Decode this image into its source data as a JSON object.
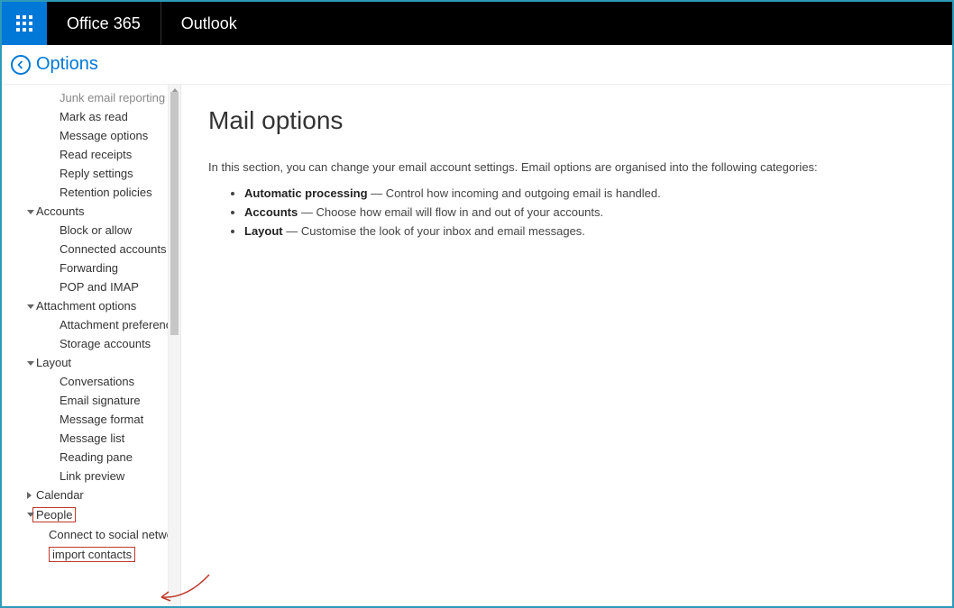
{
  "topbar": {
    "brand": "Office 365",
    "appname": "Outlook"
  },
  "subheader": {
    "back_label": "Options"
  },
  "sidebar": {
    "orphan_items": [
      "Junk email reporting",
      "Mark as read",
      "Message options",
      "Read receipts",
      "Reply settings",
      "Retention policies"
    ],
    "groups": [
      {
        "label": "Accounts",
        "expanded": true,
        "items": [
          "Block or allow",
          "Connected accounts",
          "Forwarding",
          "POP and IMAP"
        ]
      },
      {
        "label": "Attachment options",
        "expanded": true,
        "items": [
          "Attachment preference",
          "Storage accounts"
        ]
      },
      {
        "label": "Layout",
        "expanded": true,
        "items": [
          "Conversations",
          "Email signature",
          "Message format",
          "Message list",
          "Reading pane",
          "Link preview"
        ]
      },
      {
        "label": "Calendar",
        "expanded": false,
        "items": []
      },
      {
        "label": "People",
        "expanded": true,
        "highlighted": true,
        "items_raw": [
          {
            "text": "Connect to social networ",
            "highlighted": false
          },
          {
            "text": "import contacts",
            "highlighted": true
          }
        ]
      }
    ]
  },
  "main": {
    "title": "Mail options",
    "intro": "In this section, you can change your email account settings. Email options are organised into the following categories:",
    "bullets": [
      {
        "term": "Automatic processing",
        "dash": " — ",
        "desc": "Control how incoming and outgoing email is handled."
      },
      {
        "term": "Accounts",
        "dash": " — ",
        "desc": "Choose how email will flow in and out of your accounts."
      },
      {
        "term": "Layout",
        "dash": " — ",
        "desc": "Customise the look of your inbox and email messages."
      }
    ]
  }
}
